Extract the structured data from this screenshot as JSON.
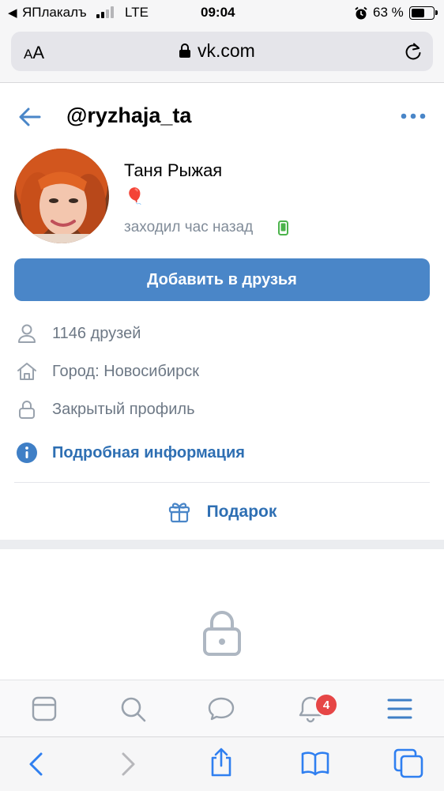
{
  "status_bar": {
    "back_app": "ЯПлакалъ",
    "network": "LTE",
    "time": "09:04",
    "battery": "63 %",
    "battery_level": 0.63
  },
  "browser": {
    "text_size_label": "AA",
    "url": "vk.com"
  },
  "profile": {
    "username": "@ryzhaja_ta",
    "name": "Таня Рыжая",
    "status_emoji": "🎈",
    "last_seen": "заходил час назад",
    "add_friend_label": "Добавить в друзья"
  },
  "info": {
    "friends": "1146 друзей",
    "city": "Город: Новосибирск",
    "privacy": "Закрытый профиль",
    "more": "Подробная информация"
  },
  "gift_label": "Подарок",
  "tabbar": {
    "notifications_badge": "4"
  },
  "colors": {
    "accent": "#4a86c8",
    "link": "#2e6fb3",
    "muted": "#818c99",
    "badge": "#e64646",
    "online_mobile": "#4bb34b"
  },
  "icons": [
    "back-arrow-icon",
    "more-dots-icon",
    "user-icon",
    "home-icon",
    "lock-icon",
    "info-icon",
    "gift-icon",
    "feed-icon",
    "search-icon",
    "messages-icon",
    "bell-icon",
    "menu-icon",
    "share-icon",
    "bookmarks-icon",
    "tabs-icon",
    "reload-icon",
    "alarm-icon",
    "secure-lock-icon",
    "phone-icon"
  ]
}
